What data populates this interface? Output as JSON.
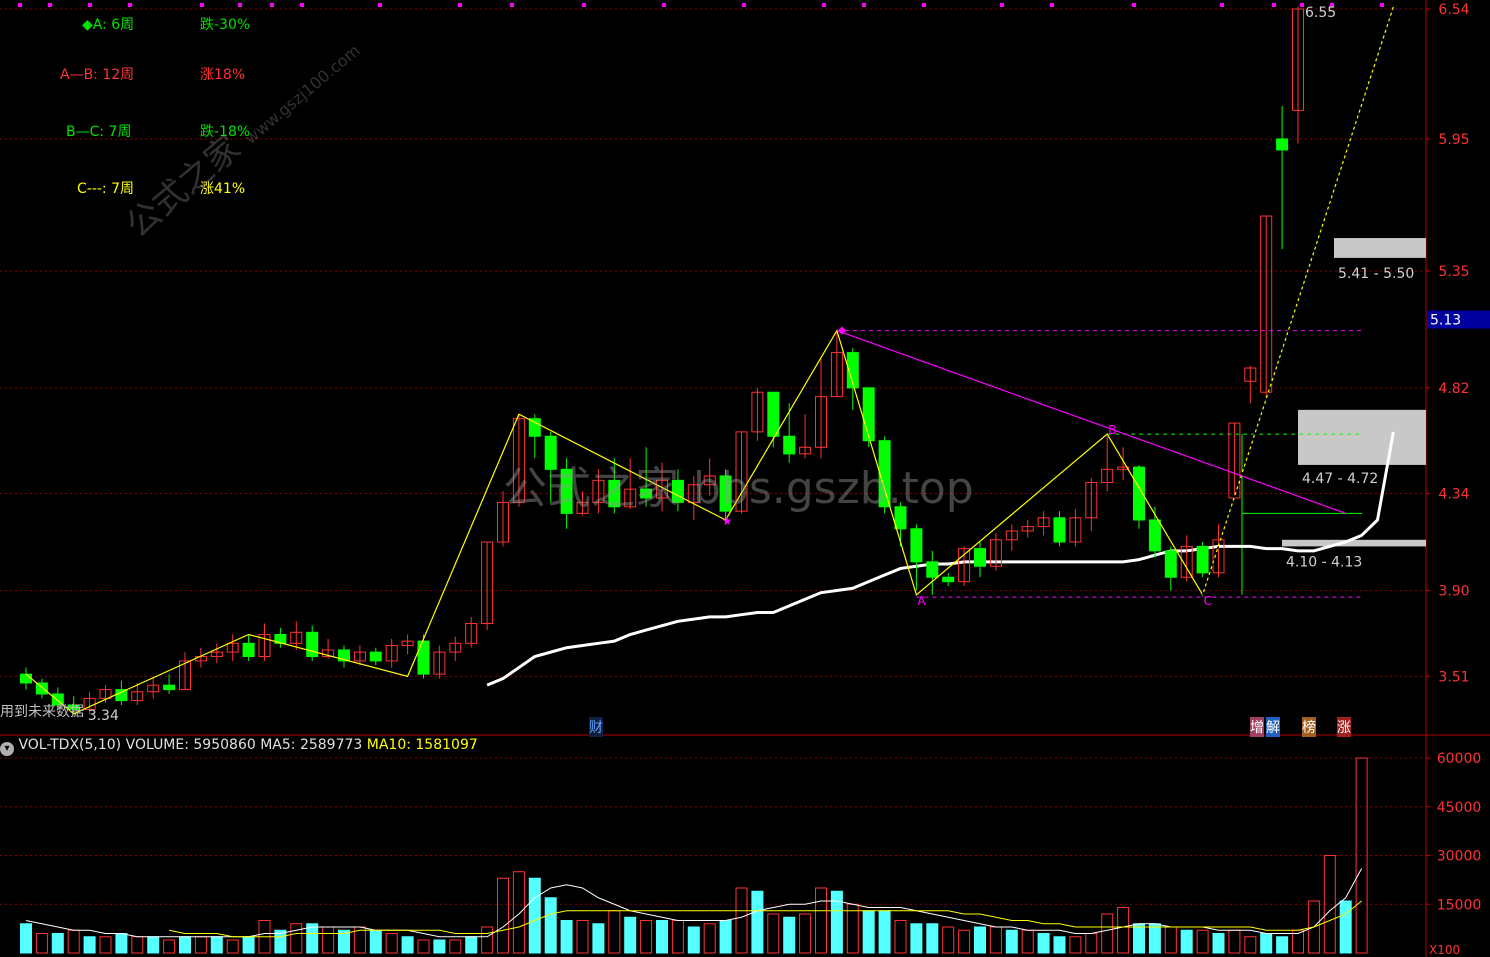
{
  "stats": [
    {
      "label": "◆A:  6周",
      "change": "跌-30%",
      "label_color": "#00e000",
      "change_color": "#00e000"
    },
    {
      "label": "A—B:  12周",
      "change": "涨18%",
      "label_color": "#ff3030",
      "change_color": "#ff3030"
    },
    {
      "label": "B—C:  7周",
      "change": "跌-18%",
      "label_color": "#00e000",
      "change_color": "#00e000"
    },
    {
      "label": "C---:  7周",
      "change": "涨41%",
      "label_color": "#ffff00",
      "change_color": "#ffff00"
    }
  ],
  "watermarks": {
    "main": "公式之家 bbs.gszb.top",
    "site": "公式之家",
    "site_url": "www.gszj100.com"
  },
  "bottom_hint": "用到未来数据",
  "markers": {
    "cai": "财",
    "zeng": "增",
    "jie": "解",
    "bang": "榜",
    "zhang": "涨"
  },
  "volume_header": {
    "indicator": "VOL-TDX(5,10)",
    "volume": "VOLUME: 5950860",
    "ma5": "MA5: 2589773",
    "ma10": "MA10: 1581097"
  },
  "colors": {
    "up": "#ff3232",
    "down": "#00ff00",
    "vol_down": "#54ffff",
    "ma5": "#ffffff",
    "ma10": "#ffff00",
    "zigzag": "#ffff00",
    "trend": "#ff00ff",
    "axis": "#b40000",
    "grid": "#8a0000",
    "price_tag_bg": "#0000a0"
  },
  "chart_data": {
    "type": "candlestick",
    "y_axis_labels": [
      "6.54",
      "5.95",
      "5.35",
      "4.82",
      "4.34",
      "3.90",
      "3.51"
    ],
    "current_price": "5.13",
    "min_label": "3.34",
    "max_label": "6.55",
    "point_labels": {
      "A": "A",
      "B": "B",
      "C": "C"
    },
    "zones": [
      {
        "label": "5.41 - 5.50",
        "low": 5.41,
        "high": 5.5
      },
      {
        "label": "4.47 - 4.72",
        "low": 4.47,
        "high": 4.72
      },
      {
        "label": "4.10 - 4.13",
        "low": 4.1,
        "high": 4.13
      }
    ],
    "candles": [
      [
        3.52,
        3.48,
        3.55,
        3.45
      ],
      [
        3.48,
        3.43,
        3.5,
        3.41
      ],
      [
        3.43,
        3.38,
        3.46,
        3.36
      ],
      [
        3.38,
        3.36,
        3.42,
        3.34
      ],
      [
        3.36,
        3.41,
        3.44,
        3.34
      ],
      [
        3.41,
        3.45,
        3.47,
        3.39
      ],
      [
        3.45,
        3.4,
        3.49,
        3.38
      ],
      [
        3.4,
        3.44,
        3.48,
        3.38
      ],
      [
        3.44,
        3.47,
        3.51,
        3.41
      ],
      [
        3.47,
        3.45,
        3.52,
        3.43
      ],
      [
        3.45,
        3.58,
        3.62,
        3.45
      ],
      [
        3.58,
        3.6,
        3.64,
        3.55
      ],
      [
        3.6,
        3.62,
        3.66,
        3.57
      ],
      [
        3.62,
        3.66,
        3.7,
        3.58
      ],
      [
        3.66,
        3.6,
        3.7,
        3.58
      ],
      [
        3.6,
        3.7,
        3.75,
        3.58
      ],
      [
        3.7,
        3.66,
        3.73,
        3.64
      ],
      [
        3.66,
        3.71,
        3.76,
        3.63
      ],
      [
        3.71,
        3.6,
        3.74,
        3.58
      ],
      [
        3.6,
        3.63,
        3.68,
        3.59
      ],
      [
        3.63,
        3.58,
        3.65,
        3.55
      ],
      [
        3.58,
        3.62,
        3.65,
        3.56
      ],
      [
        3.62,
        3.58,
        3.64,
        3.56
      ],
      [
        3.58,
        3.65,
        3.68,
        3.55
      ],
      [
        3.65,
        3.67,
        3.7,
        3.61
      ],
      [
        3.67,
        3.52,
        3.7,
        3.5
      ],
      [
        3.52,
        3.62,
        3.65,
        3.5
      ],
      [
        3.62,
        3.66,
        3.69,
        3.58
      ],
      [
        3.66,
        3.75,
        3.78,
        3.64
      ],
      [
        3.75,
        4.12,
        4.12,
        3.72
      ],
      [
        4.12,
        4.3,
        4.35,
        4.1
      ],
      [
        4.3,
        4.68,
        4.7,
        4.28
      ],
      [
        4.68,
        4.6,
        4.7,
        4.5
      ],
      [
        4.6,
        4.45,
        4.62,
        4.3
      ],
      [
        4.45,
        4.25,
        4.5,
        4.18
      ],
      [
        4.25,
        4.3,
        4.35,
        4.24
      ],
      [
        4.3,
        4.4,
        4.45,
        4.25
      ],
      [
        4.4,
        4.28,
        4.5,
        4.25
      ],
      [
        4.28,
        4.36,
        4.5,
        4.27
      ],
      [
        4.36,
        4.32,
        4.55,
        4.28
      ],
      [
        4.32,
        4.4,
        4.48,
        4.26
      ],
      [
        4.4,
        4.3,
        4.45,
        4.26
      ],
      [
        4.3,
        4.38,
        4.42,
        4.22
      ],
      [
        4.38,
        4.42,
        4.5,
        4.33
      ],
      [
        4.42,
        4.26,
        4.45,
        4.2
      ],
      [
        4.26,
        4.62,
        4.62,
        4.25
      ],
      [
        4.62,
        4.8,
        4.82,
        4.58
      ],
      [
        4.8,
        4.6,
        4.8,
        4.55
      ],
      [
        4.6,
        4.52,
        4.75,
        4.48
      ],
      [
        4.52,
        4.55,
        4.7,
        4.5
      ],
      [
        4.55,
        4.78,
        4.95,
        4.5
      ],
      [
        4.78,
        4.98,
        5.08,
        4.78
      ],
      [
        4.98,
        4.82,
        5.0,
        4.72
      ],
      [
        4.82,
        4.58,
        4.82,
        4.55
      ],
      [
        4.58,
        4.28,
        4.6,
        4.25
      ],
      [
        4.28,
        4.18,
        4.3,
        4.1
      ],
      [
        4.18,
        4.03,
        4.2,
        3.9
      ],
      [
        4.03,
        3.96,
        4.08,
        3.88
      ],
      [
        3.96,
        3.94,
        3.98,
        3.92
      ],
      [
        3.94,
        4.09,
        4.1,
        3.92
      ],
      [
        4.09,
        4.01,
        4.12,
        3.96
      ],
      [
        4.01,
        4.13,
        4.16,
        3.99
      ],
      [
        4.13,
        4.17,
        4.2,
        4.08
      ],
      [
        4.17,
        4.19,
        4.22,
        4.14
      ],
      [
        4.19,
        4.23,
        4.26,
        4.15
      ],
      [
        4.23,
        4.12,
        4.26,
        4.1
      ],
      [
        4.12,
        4.23,
        4.27,
        4.1
      ],
      [
        4.23,
        4.39,
        4.41,
        4.17
      ],
      [
        4.39,
        4.45,
        4.6,
        4.35
      ],
      [
        4.45,
        4.46,
        4.55,
        4.4
      ],
      [
        4.46,
        4.22,
        4.47,
        4.18
      ],
      [
        4.22,
        4.08,
        4.28,
        4.05
      ],
      [
        4.08,
        3.96,
        4.1,
        3.9
      ],
      [
        3.96,
        4.1,
        4.15,
        3.94
      ],
      [
        4.1,
        3.98,
        4.12,
        3.96
      ],
      [
        3.98,
        4.13,
        4.2,
        3.96
      ],
      [
        4.32,
        4.66,
        4.66,
        4.32
      ],
      [
        4.85,
        4.91,
        4.92,
        4.75
      ],
      [
        4.8,
        5.6,
        5.6,
        4.77
      ],
      [
        5.95,
        5.9,
        6.1,
        5.45
      ],
      [
        6.08,
        6.54,
        6.55,
        5.93
      ]
    ],
    "ma_white": [
      null,
      null,
      null,
      null,
      null,
      null,
      null,
      null,
      null,
      null,
      null,
      null,
      null,
      null,
      null,
      null,
      null,
      null,
      null,
      null,
      null,
      null,
      null,
      null,
      null,
      null,
      null,
      null,
      null,
      3.47,
      3.5,
      3.55,
      3.6,
      3.62,
      3.64,
      3.65,
      3.66,
      3.67,
      3.7,
      3.72,
      3.74,
      3.76,
      3.77,
      3.78,
      3.78,
      3.79,
      3.8,
      3.8,
      3.83,
      3.86,
      3.89,
      3.9,
      3.91,
      3.94,
      3.97,
      4.0,
      4.01,
      4.02,
      4.02,
      4.03,
      4.03,
      4.03,
      4.03,
      4.03,
      4.03,
      4.03,
      4.03,
      4.03,
      4.03,
      4.03,
      4.04,
      4.06,
      4.08,
      4.08,
      4.09,
      4.1,
      4.1,
      4.1,
      4.09,
      4.09,
      4.08,
      4.08,
      4.1,
      4.12,
      4.15,
      4.22,
      4.62
    ],
    "zigzag_pts": [
      [
        0,
        3.52
      ],
      [
        3,
        3.34
      ],
      [
        14,
        3.7
      ],
      [
        24,
        3.51
      ],
      [
        31,
        4.7
      ],
      [
        44,
        4.22
      ],
      [
        51,
        5.08
      ],
      [
        56,
        3.88
      ],
      [
        68,
        4.61
      ],
      [
        74,
        3.88
      ],
      [
        86,
        6.55
      ]
    ],
    "trend_line": [
      [
        51,
        5.08
      ],
      [
        83,
        4.25
      ]
    ],
    "volume_axis_labels": [
      "60000",
      "45000",
      "30000",
      "15000"
    ],
    "volume_axis_unit": "X100",
    "volume": [
      [
        0,
        9
      ],
      [
        1,
        6
      ],
      [
        0,
        6
      ],
      [
        1,
        7
      ],
      [
        0,
        5
      ],
      [
        1,
        5
      ],
      [
        0,
        6
      ],
      [
        1,
        5
      ],
      [
        0,
        5
      ],
      [
        1,
        4
      ],
      [
        0,
        5
      ],
      [
        1,
        5
      ],
      [
        0,
        5
      ],
      [
        1,
        4
      ],
      [
        0,
        5
      ],
      [
        1,
        10
      ],
      [
        0,
        7
      ],
      [
        1,
        9
      ],
      [
        0,
        9
      ],
      [
        1,
        8
      ],
      [
        0,
        7
      ],
      [
        1,
        8
      ],
      [
        0,
        7
      ],
      [
        1,
        6
      ],
      [
        0,
        5
      ],
      [
        1,
        4
      ],
      [
        0,
        4
      ],
      [
        1,
        4
      ],
      [
        0,
        5
      ],
      [
        1,
        8
      ],
      [
        1,
        23
      ],
      [
        1,
        25
      ],
      [
        0,
        23
      ],
      [
        0,
        17
      ],
      [
        0,
        10
      ],
      [
        1,
        10
      ],
      [
        0,
        9
      ],
      [
        1,
        13
      ],
      [
        0,
        11
      ],
      [
        1,
        10
      ],
      [
        0,
        10
      ],
      [
        1,
        10
      ],
      [
        0,
        8
      ],
      [
        1,
        9
      ],
      [
        0,
        10
      ],
      [
        1,
        20
      ],
      [
        0,
        19
      ],
      [
        1,
        12
      ],
      [
        0,
        11
      ],
      [
        1,
        12
      ],
      [
        1,
        20
      ],
      [
        0,
        19
      ],
      [
        1,
        15
      ],
      [
        0,
        13
      ],
      [
        0,
        13
      ],
      [
        1,
        10
      ],
      [
        0,
        9
      ],
      [
        0,
        9
      ],
      [
        1,
        8
      ],
      [
        1,
        7
      ],
      [
        0,
        8
      ],
      [
        1,
        8
      ],
      [
        0,
        7
      ],
      [
        1,
        7
      ],
      [
        0,
        6
      ],
      [
        0,
        5
      ],
      [
        1,
        5
      ],
      [
        1,
        6
      ],
      [
        1,
        12
      ],
      [
        1,
        14
      ],
      [
        0,
        9
      ],
      [
        0,
        9
      ],
      [
        1,
        8
      ],
      [
        0,
        7
      ],
      [
        1,
        7
      ],
      [
        0,
        6
      ],
      [
        1,
        7
      ],
      [
        1,
        5
      ],
      [
        0,
        6
      ],
      [
        0,
        5
      ],
      [
        1,
        7
      ],
      [
        1,
        16
      ],
      [
        1,
        30
      ],
      [
        0,
        16
      ],
      [
        1,
        60
      ]
    ],
    "vol_ma5": [
      10,
      9,
      8,
      7,
      7,
      6,
      6,
      5,
      5,
      5,
      5,
      5,
      5,
      5,
      5,
      6,
      6,
      7,
      8,
      8,
      8,
      8,
      7,
      7,
      7,
      6,
      5,
      5,
      5,
      5,
      8,
      12,
      17,
      20,
      21,
      20,
      17,
      15,
      13,
      12,
      11,
      10,
      10,
      10,
      10,
      11,
      13,
      14,
      15,
      15,
      16,
      16,
      15,
      14,
      14,
      14,
      13,
      12,
      11,
      10,
      9,
      8,
      8,
      7,
      7,
      7,
      6,
      6,
      7,
      8,
      9,
      9,
      8,
      8,
      8,
      7,
      7,
      7,
      6,
      6,
      6,
      8,
      13,
      17,
      26
    ],
    "vol_ma10": [
      null,
      null,
      null,
      null,
      null,
      null,
      null,
      null,
      null,
      7,
      6,
      6,
      6,
      5,
      5,
      5,
      5,
      6,
      6,
      6,
      6,
      7,
      7,
      7,
      7,
      7,
      7,
      6,
      6,
      6,
      7,
      8,
      10,
      12,
      13,
      13,
      13,
      13,
      13,
      13,
      13,
      13,
      13,
      13,
      13,
      13,
      13,
      13,
      13,
      13,
      13,
      13,
      13,
      13,
      13,
      13,
      13,
      13,
      13,
      12,
      12,
      11,
      10,
      10,
      9,
      9,
      8,
      8,
      8,
      8,
      8,
      8,
      8,
      8,
      8,
      8,
      8,
      8,
      7,
      7,
      7,
      8,
      10,
      12,
      16
    ]
  }
}
